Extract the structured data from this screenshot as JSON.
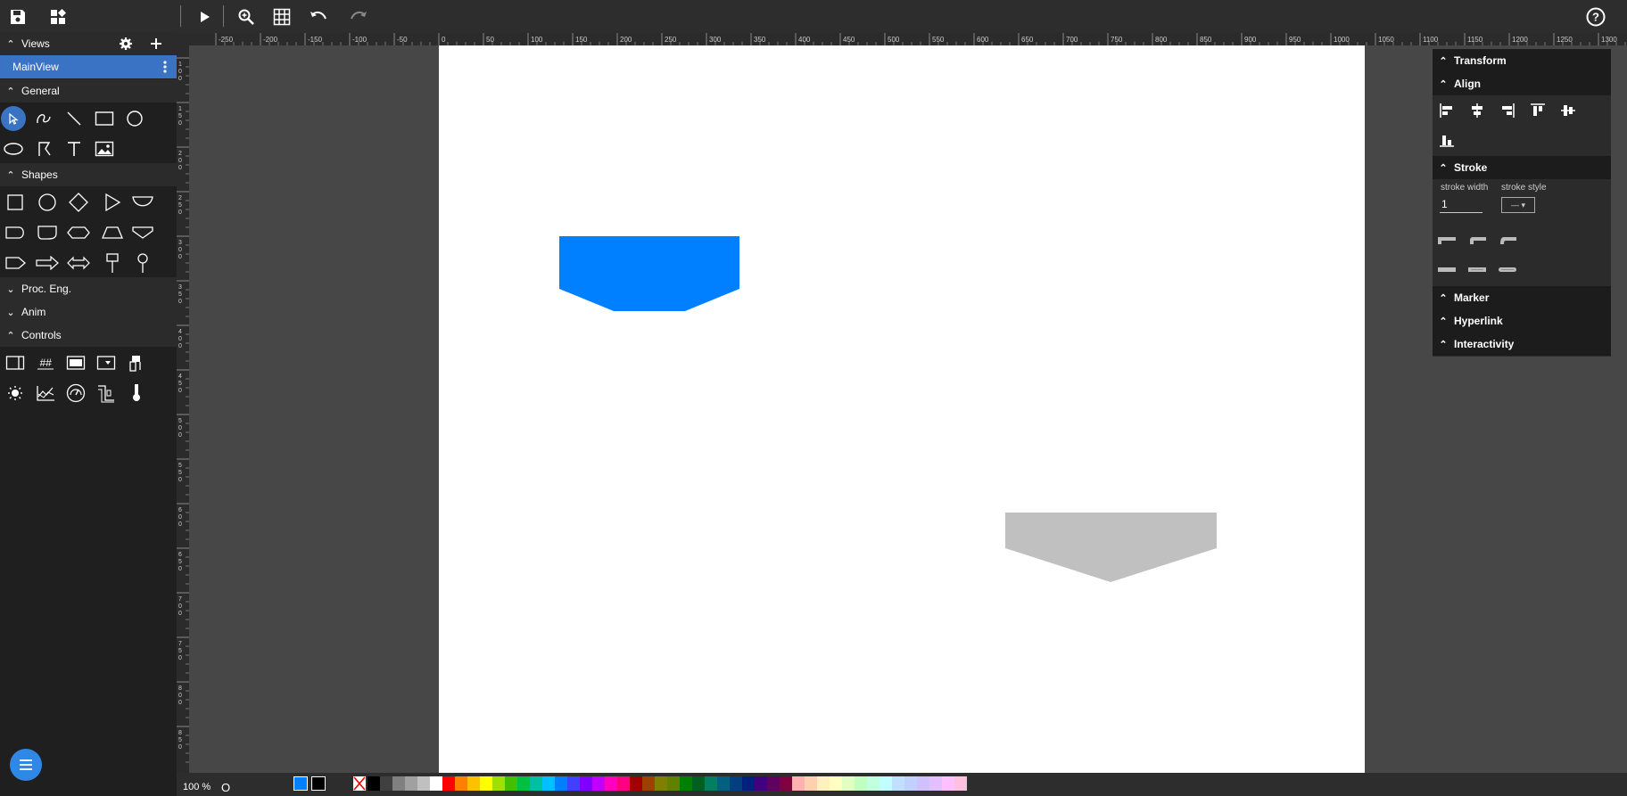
{
  "toolbar": {
    "save_icon": "save-icon",
    "widgets_icon": "widgets-icon",
    "play_icon": "play-icon",
    "zoom_icon": "zoom-icon",
    "grid_icon": "grid-icon",
    "undo_icon": "undo-icon",
    "redo_icon": "redo-icon",
    "help_icon": "help-icon"
  },
  "sidebar": {
    "views_label": "Views",
    "mainview_label": "MainView",
    "general_label": "General",
    "shapes_label": "Shapes",
    "proc_label": "Proc. Eng.",
    "anim_label": "Anim",
    "controls_label": "Controls"
  },
  "ruler": {
    "h_ticks": [
      "-250",
      "-200",
      "-150",
      "-100",
      "-50",
      "0",
      "50",
      "100",
      "150",
      "200",
      "250",
      "300",
      "350",
      "400",
      "450",
      "500",
      "550",
      "600",
      "650",
      "700",
      "750",
      "800",
      "850",
      "900",
      "950",
      "1000",
      "1050",
      "1100",
      "1150",
      "1200",
      "1250",
      "1300"
    ],
    "v_ticks": [
      "100",
      "150",
      "200",
      "250",
      "300",
      "350",
      "400",
      "450",
      "500",
      "550",
      "600",
      "650",
      "700",
      "750",
      "800",
      "850"
    ]
  },
  "rightpanel": {
    "transform_label": "Transform",
    "align_label": "Align",
    "stroke_label": "Stroke",
    "stroke_width_label": "stroke width",
    "stroke_style_label": "stroke style",
    "stroke_width_value": "1",
    "stroke_style_value": "— ▾",
    "marker_label": "Marker",
    "hyperlink_label": "Hyperlink",
    "interactivity_label": "Interactivity"
  },
  "bottom": {
    "zoom_value": "100 %",
    "zoom_reset": "O",
    "fill_color": "#0080ff",
    "stroke_color": "#000000",
    "palette": [
      "#000000",
      "#404040",
      "#808080",
      "#a0a0a0",
      "#c0c0c0",
      "#ffffff",
      "#ff0000",
      "#ff8000",
      "#ffc000",
      "#ffff00",
      "#a0e000",
      "#40c000",
      "#00c040",
      "#00c0a0",
      "#00c0ff",
      "#0080ff",
      "#4040ff",
      "#8000ff",
      "#c000ff",
      "#ff00c0",
      "#ff0080",
      "#a00000",
      "#a04000",
      "#808000",
      "#608000",
      "#008000",
      "#006020",
      "#008060",
      "#006080",
      "#004080",
      "#002080",
      "#400080",
      "#600060",
      "#800040",
      "#ffb0b0",
      "#ffd0b0",
      "#fff0c0",
      "#ffffc0",
      "#e0ffc0",
      "#c0ffc0",
      "#c0ffe0",
      "#c0ffff",
      "#c0e0ff",
      "#c0d0ff",
      "#d0c0ff",
      "#e0c0ff",
      "#ffc0ff",
      "#ffc0e0"
    ]
  },
  "canvas": {
    "shape1_color": "#0080ff",
    "shape2_color": "#c0c0c0"
  }
}
